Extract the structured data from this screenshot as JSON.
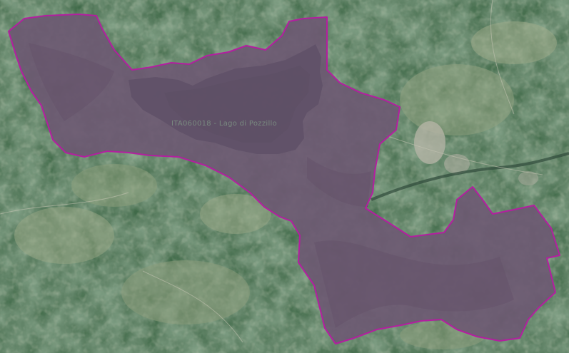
{
  "map": {
    "area_label": "ITA060018 - Lago di Pozzillo",
    "colors": {
      "boundary": "#b41ea0",
      "hatch": "#c8507a",
      "lake": "#2c3540",
      "terrain_green": "#4f7a55",
      "terrain_light": "#9aa886",
      "town": "#b8b6a8",
      "protected_tint": "#6e5a72"
    },
    "icons": [
      "protected-area-hatch-pattern"
    ]
  }
}
